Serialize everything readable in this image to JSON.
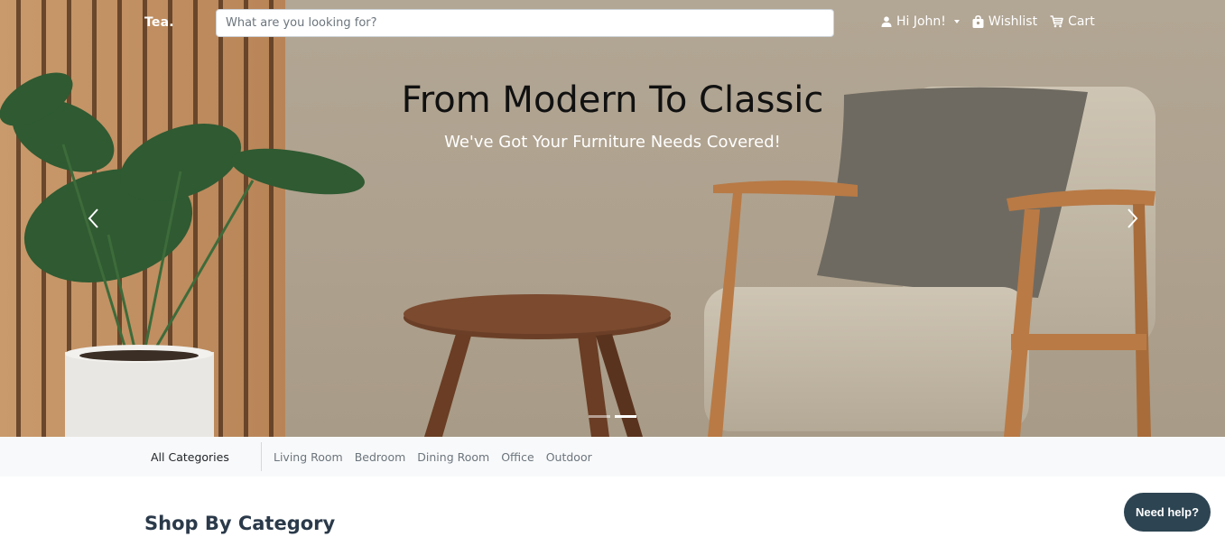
{
  "navbar": {
    "brand": "Tea.",
    "search_placeholder": "What are you looking for?",
    "user_label": "Hi John!",
    "wishlist_label": "Wishlist",
    "cart_label": "Cart",
    "icons": [
      "user-icon",
      "chevron-down-icon",
      "shopping-bag-icon",
      "cart-icon"
    ]
  },
  "hero": {
    "title": "From Modern To Classic",
    "subtitle": "We've Got Your Furniture Needs Covered!",
    "slides_count": 2,
    "active_slide": 2
  },
  "categories": {
    "all_label": "All Categories",
    "links": [
      "Living Room",
      "Bedroom",
      "Dining Room",
      "Office",
      "Outdoor"
    ]
  },
  "section": {
    "title": "Shop By Category"
  },
  "help": {
    "label": "Need help?"
  },
  "colors": {
    "hero_bg": "#aea18e",
    "help_button": "#2d4452",
    "category_bar": "#f8f9fa",
    "section_title": "#2b3a4a"
  }
}
